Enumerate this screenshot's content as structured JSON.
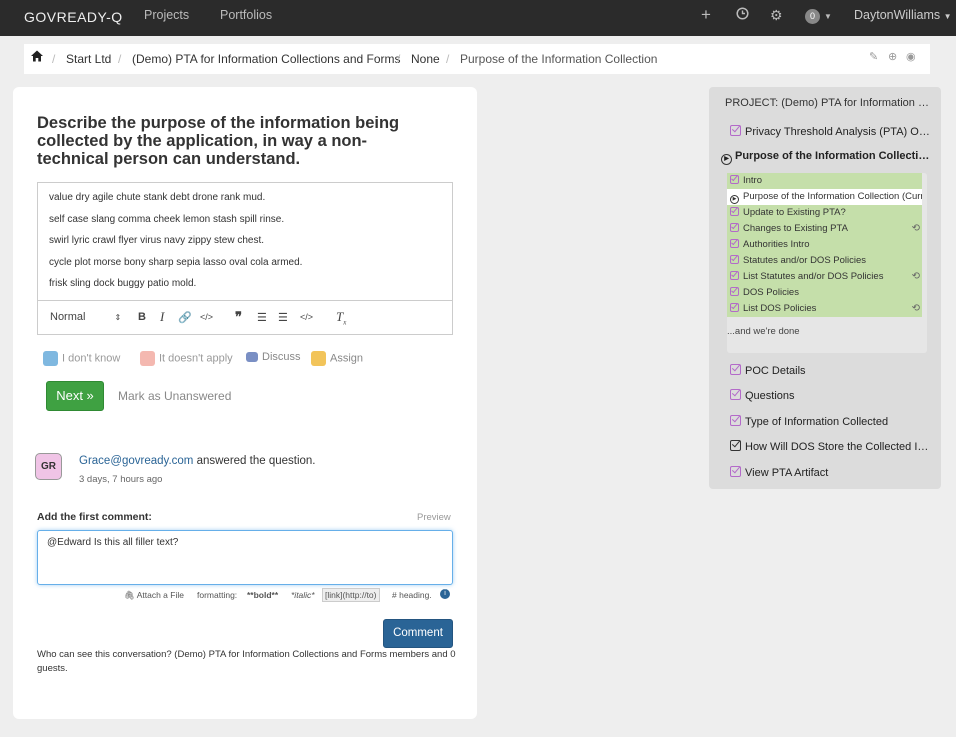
{
  "navbar": {
    "brand": "GOVREADY-Q",
    "links": [
      "Projects",
      "Portfolios"
    ],
    "notification_count": "0",
    "username": "DaytonWilliams"
  },
  "breadcrumb": {
    "items": [
      "Start Ltd",
      "(Demo) PTA for Information Collections and Forms",
      "None"
    ],
    "current": "Purpose of the Information Collection"
  },
  "question": {
    "title": "Describe the purpose of the information being collected by the application, in way a non-technical person can understand.",
    "answer_lines": [
      "value dry agile chute stank debt drone rank mud.",
      "self case slang comma cheek lemon stash spill rinse.",
      "swirl lyric crawl flyer virus navy zippy stew chest.",
      "cycle plot morse bony sharp sepia lasso oval cola armed.",
      "frisk sling dock buggy patio mold."
    ],
    "format_select": "Normal"
  },
  "actions": {
    "dont_know": "I don't know",
    "doesnt_apply": "It doesn't apply",
    "discuss": "Discuss",
    "assign": "Assign",
    "next": "Next »",
    "mark_unanswered": "Mark as Unanswered"
  },
  "answer_info": {
    "avatar": "GR",
    "user": "Grace@govready.com",
    "action": "answered the question.",
    "time": "3 days, 7 hours ago"
  },
  "comment": {
    "label": "Add the first comment:",
    "preview": "Preview",
    "value": "@Edward Is this all filler text?",
    "attach": "Attach a File",
    "formatting": "formatting:",
    "bold": "**bold**",
    "italic": "*italic*",
    "link": "[link](http://to)",
    "heading": "# heading.",
    "button": "Comment",
    "visibility": "Who can see this conversation? (Demo) PTA for Information Collections and Forms members and 0 guests."
  },
  "sidebar": {
    "project": "PROJECT:  (Demo) PTA for Information Collections and Forms",
    "items_top": [
      {
        "label": "Privacy Threshold Analysis (PTA) Overview",
        "icon": "check-icon"
      },
      {
        "label": "Purpose of the Information Collection",
        "icon": "current-icon"
      }
    ],
    "sub_items": [
      {
        "label": "Intro",
        "icon": "check-icon",
        "loop": false
      },
      {
        "label": "Purpose of the Information Collection (Current)",
        "icon": "current-icon",
        "loop": false
      },
      {
        "label": "Update to Existing PTA?",
        "icon": "check-icon",
        "loop": false
      },
      {
        "label": "Changes to Existing PTA",
        "icon": "check-icon",
        "loop": true
      },
      {
        "label": "Authorities Intro",
        "icon": "check-icon",
        "loop": false
      },
      {
        "label": "Statutes and/or DOS Policies",
        "icon": "check-icon",
        "loop": false
      },
      {
        "label": "List Statutes and/or DOS Policies",
        "icon": "check-icon",
        "loop": true
      },
      {
        "label": "DOS Policies",
        "icon": "check-icon",
        "loop": false
      },
      {
        "label": "List DOS Policies",
        "icon": "check-icon",
        "loop": true
      }
    ],
    "done": "...and we're done",
    "items_bottom": [
      {
        "label": "POC Details",
        "icon": "check-icon"
      },
      {
        "label": "Questions",
        "icon": "check-icon"
      },
      {
        "label": "Type of Information Collected",
        "icon": "check-icon"
      },
      {
        "label": "How Will DOS Store the Collected Information?",
        "icon": "edit-icon"
      },
      {
        "label": "View PTA Artifact",
        "icon": "check-icon"
      }
    ]
  }
}
